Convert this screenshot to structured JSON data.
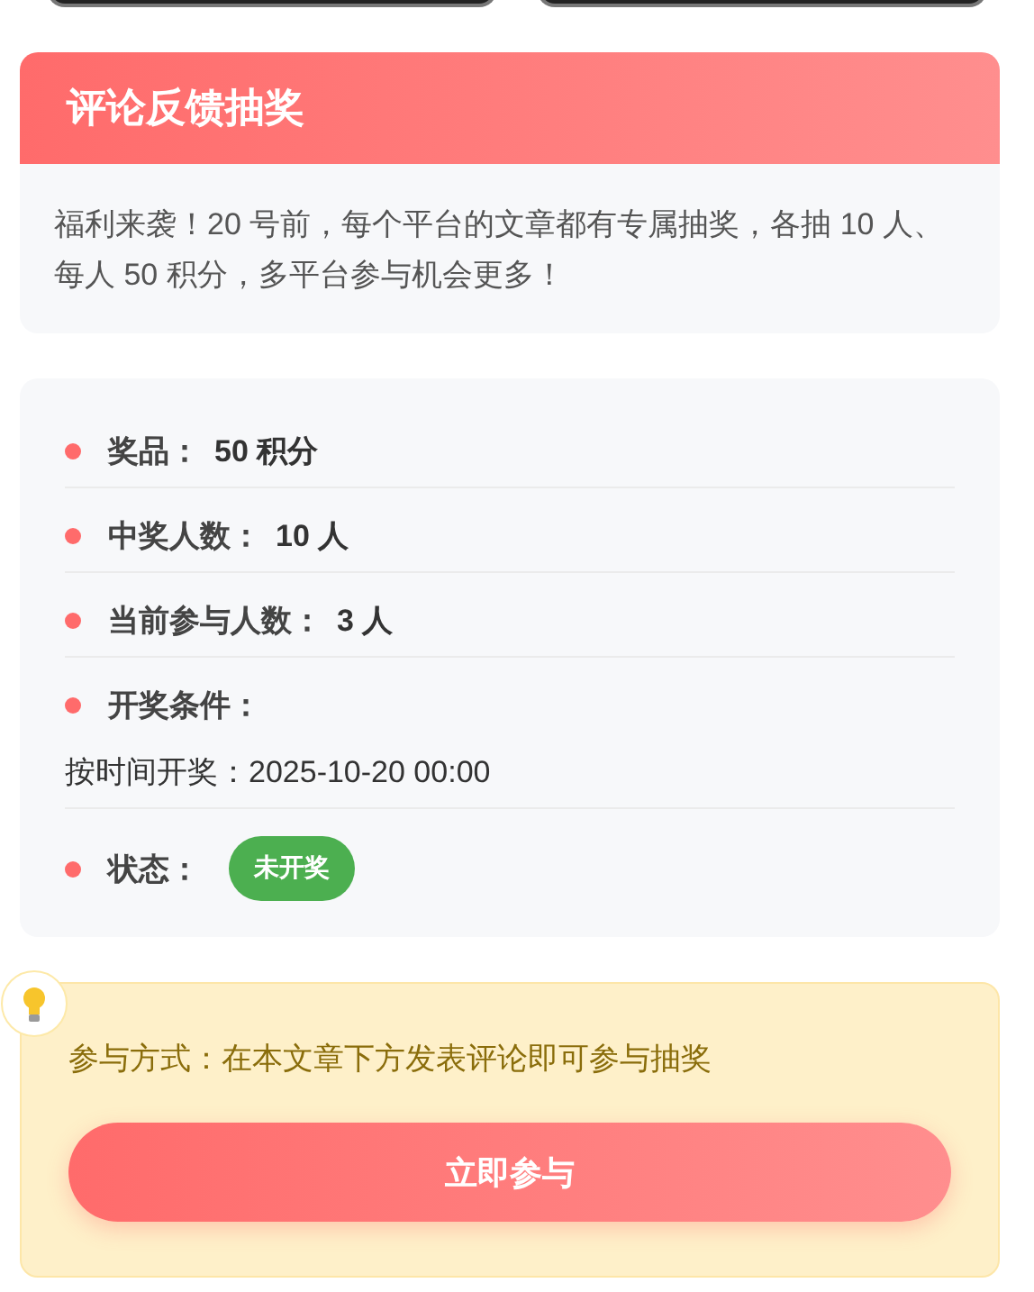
{
  "top_buttons": [
    {
      "kind": "cut"
    },
    {
      "kind": "cut"
    }
  ],
  "lottery": {
    "title": "评论反馈抽奖",
    "description": "福利来袭！20 号前，每个平台的文章都有专属抽奖，各抽 10 人、每人 50 积分，多平台参与机会更多！"
  },
  "details": [
    {
      "kind": "field",
      "label": "奖品：",
      "value": "50 积分"
    },
    {
      "kind": "field",
      "label": "中奖人数：",
      "value": "10 人"
    },
    {
      "kind": "field",
      "label": "当前参与人数：",
      "value": "3 人"
    },
    {
      "kind": "condition",
      "label": "开奖条件：",
      "detail": "按时间开奖：2025-10-20 00:00"
    },
    {
      "kind": "status",
      "label": "状态：",
      "badge": "未开奖",
      "color": "#4caf50"
    }
  ],
  "tip": {
    "text": "参与方式：在本文章下方发表评论即可参与抽奖",
    "button": "立即参与"
  }
}
